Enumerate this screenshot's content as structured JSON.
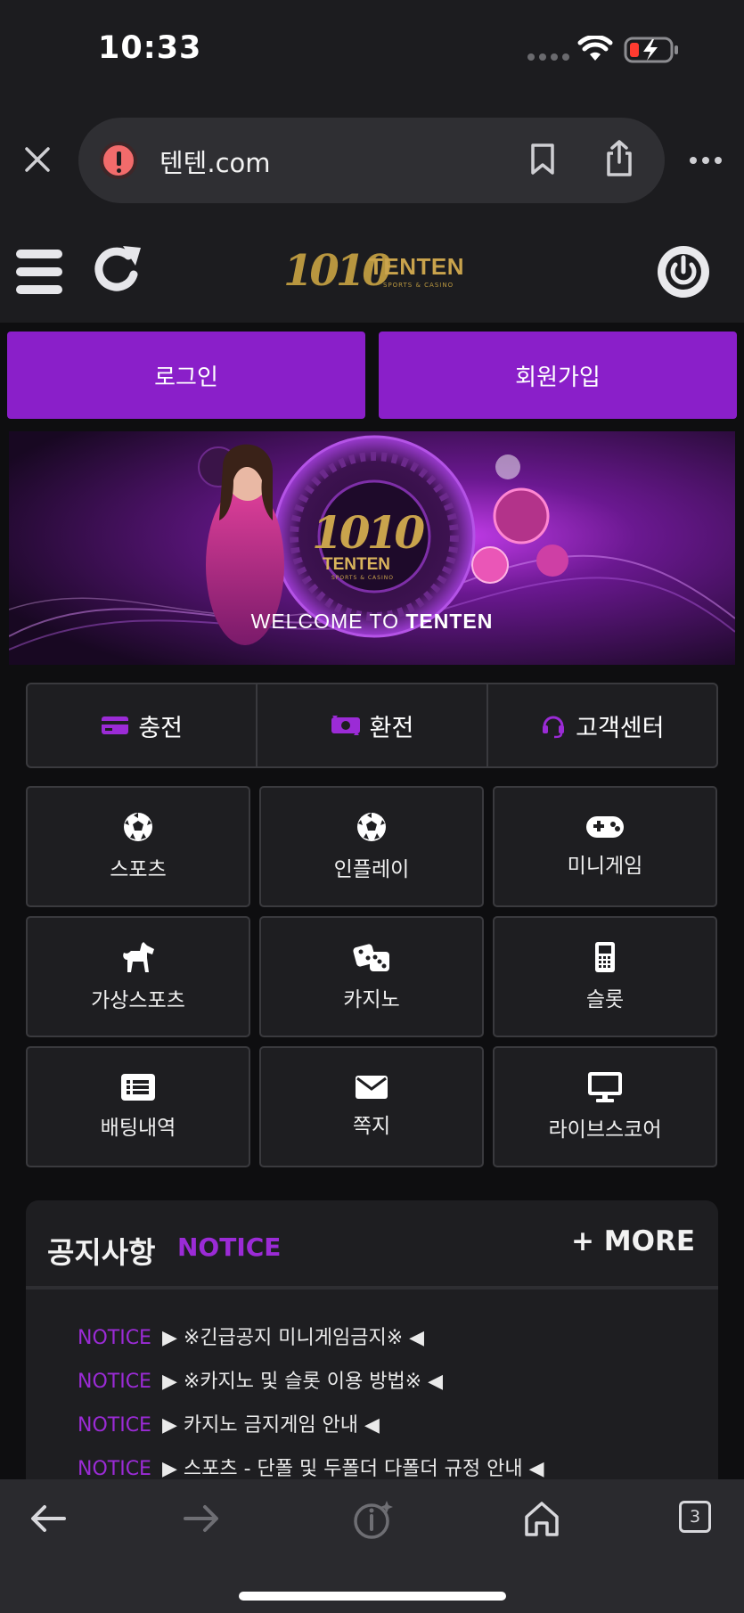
{
  "status_bar": {
    "time": "10:33"
  },
  "browser": {
    "url": "텐텐.com",
    "tabs_count": "3"
  },
  "site": {
    "logo_number": "1010",
    "logo_name": "TENTEN",
    "logo_subtitle": "SPORTS & CASINO"
  },
  "auth": {
    "login_label": "로그인",
    "signup_label": "회원가입"
  },
  "banner": {
    "logo_number": "1010",
    "logo_name": "TENTEN",
    "logo_subtitle": "SPORTS & CASINO",
    "welcome_prefix": "WELCOME TO ",
    "welcome_brand": "TENTEN"
  },
  "quick_menu": [
    {
      "label": "충전",
      "icon": "credit-card-icon"
    },
    {
      "label": "환전",
      "icon": "exchange-icon"
    },
    {
      "label": "고객센터",
      "icon": "headset-icon"
    }
  ],
  "menu_tiles": [
    {
      "label": "스포츠",
      "icon": "soccer-ball-icon"
    },
    {
      "label": "인플레이",
      "icon": "soccer-ball-icon"
    },
    {
      "label": "미니게임",
      "icon": "gamepad-icon"
    },
    {
      "label": "가상스포츠",
      "icon": "horse-icon"
    },
    {
      "label": "카지노",
      "icon": "dice-icon"
    },
    {
      "label": "슬롯",
      "icon": "mobile-phone-icon"
    },
    {
      "label": "배팅내역",
      "icon": "list-icon"
    },
    {
      "label": "쪽지",
      "icon": "envelope-icon"
    },
    {
      "label": "라이브스코어",
      "icon": "monitor-icon"
    }
  ],
  "notice": {
    "title": "공지사항",
    "subtitle": "NOTICE",
    "more_label": "+ MORE",
    "items": [
      {
        "tag": "NOTICE",
        "text": "▶ ※긴급공지 미니게임금지※ ◀"
      },
      {
        "tag": "NOTICE",
        "text": "▶ ※카지노 및 슬롯 이용 방법※ ◀"
      },
      {
        "tag": "NOTICE",
        "text": "▶ 카지노 금지게임 안내 ◀"
      },
      {
        "tag": "NOTICE",
        "text": "▶ 스포츠 - 단폴 및 두폴더 다폴더 규정 안내 ◀"
      }
    ]
  },
  "colors": {
    "accent": "#8a1fc9",
    "accent_text": "#9b2bd6",
    "gold": "#c9a34c",
    "panel": "#1e1e21"
  }
}
